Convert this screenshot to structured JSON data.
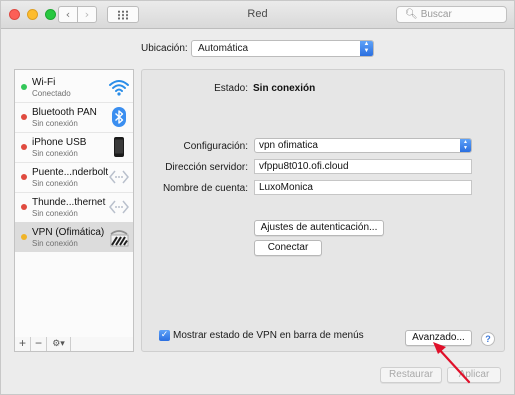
{
  "window": {
    "title": "Red",
    "search_placeholder": "Buscar"
  },
  "location": {
    "label": "Ubicación:",
    "value": "Automática"
  },
  "services": [
    {
      "name": "Wi-Fi",
      "status": "Conectado",
      "status_color": "#34c759",
      "icon": "wifi-icon"
    },
    {
      "name": "Bluetooth PAN",
      "status": "Sin conexión",
      "status_color": "#e04b3f",
      "icon": "bluetooth-icon"
    },
    {
      "name": "iPhone USB",
      "status": "Sin conexión",
      "status_color": "#e04b3f",
      "icon": "iphone-icon"
    },
    {
      "name": "Puente...nderbolt",
      "status": "Sin conexión",
      "status_color": "#e04b3f",
      "icon": "thunderbolt-bridge-icon"
    },
    {
      "name": "Thunde...thernet",
      "status": "Sin conexión",
      "status_color": "#e04b3f",
      "icon": "thunderbolt-ethernet-icon"
    },
    {
      "name": "VPN (Ofimática)",
      "status": "Sin conexión",
      "status_color": "#f0b428",
      "icon": "vpn-icon",
      "selected": true
    }
  ],
  "sidebar_controls": {
    "add": "+",
    "remove": "−",
    "actions": "⚙▾"
  },
  "detail": {
    "status_label": "Estado:",
    "status_value": "Sin conexión",
    "config_label": "Configuración:",
    "config_value": "vpn ofimatica",
    "server_label": "Dirección servidor:",
    "server_value": "vfppu8t010.ofi.cloud",
    "account_label": "Nombre de cuenta:",
    "account_value": "LuxoMonica",
    "auth_button": "Ajustes de autenticación...",
    "connect_button": "Conectar",
    "show_vpn_status_label": "Mostrar estado de VPN en barra de menús",
    "show_vpn_status_checked": true,
    "advanced_button": "Avanzado...",
    "help": "?"
  },
  "footer": {
    "revert_button": "Restaurar",
    "apply_button": "Aplicar"
  },
  "colors": {
    "accent": "#2b6fe0",
    "annotation_arrow": "#e0102a"
  }
}
